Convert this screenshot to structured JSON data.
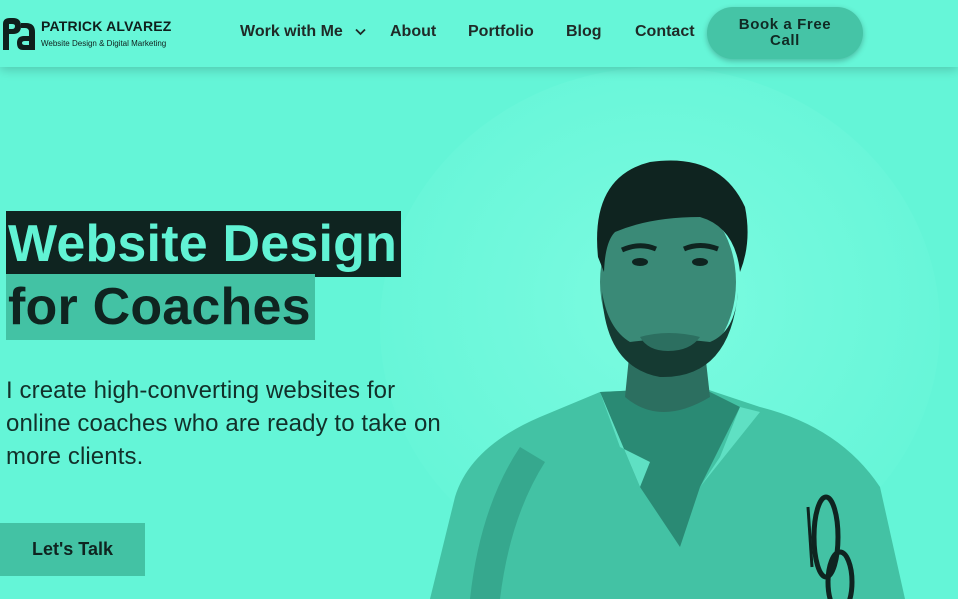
{
  "brand": {
    "name": "PATRICK ALVAREZ",
    "tagline": "Website Design & Digital Marketing"
  },
  "nav": {
    "items": [
      {
        "label": "Work with Me",
        "has_dropdown": true
      },
      {
        "label": "About"
      },
      {
        "label": "Portfolio"
      },
      {
        "label": "Blog"
      },
      {
        "label": "Contact"
      }
    ],
    "cta_label": "Book a Free Call"
  },
  "hero": {
    "headline_line1": "Website Design",
    "headline_line2": "for Coaches",
    "subcopy": "I create high-converting websites for online coaches who are ready to take on more clients.",
    "button_label": "Let's Talk"
  },
  "colors": {
    "accent": "#64f5d7",
    "accent_dark": "#43c2a4",
    "ink": "#0f2420"
  },
  "icons": {
    "dropdown": "chevron-down-icon",
    "logo": "pa-monogram-icon"
  }
}
